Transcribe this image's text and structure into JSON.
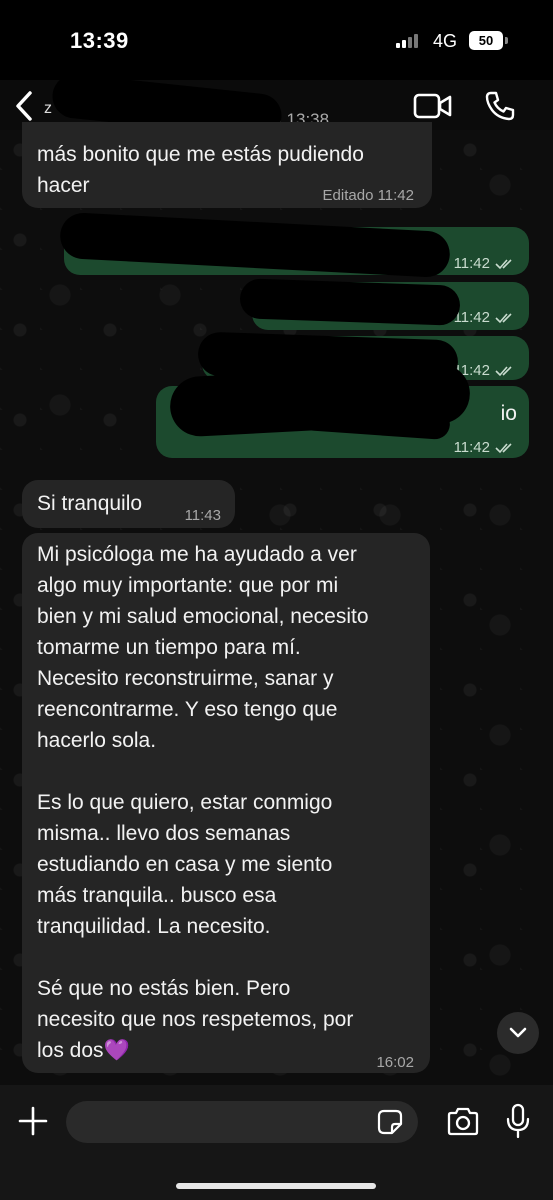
{
  "status_bar": {
    "time": "13:39",
    "network": "4G",
    "battery": "50"
  },
  "header": {
    "contact_initial": "z",
    "last_seen": "(s) 13:38"
  },
  "messages": [
    {
      "direction": "in",
      "text": "más bonito que me estás pudiendo\nhacer",
      "meta": "Editado 11:42"
    },
    {
      "direction": "out",
      "text": "",
      "meta": "11:42"
    },
    {
      "direction": "out",
      "text": "",
      "meta": "11:42"
    },
    {
      "direction": "out",
      "text": "",
      "meta": "11:42"
    },
    {
      "direction": "out",
      "text": "",
      "partial_visible": "io",
      "meta": "11:42"
    },
    {
      "direction": "in",
      "text": "Si tranquilo",
      "meta": "11:43"
    },
    {
      "direction": "in",
      "text": "Mi psicóloga me ha ayudado a ver\nalgo muy importante: que por mi\nbien y mi salud emocional, necesito\ntomarme un tiempo para mí.\nNecesito reconstruirme, sanar y\nreencontrarme. Y eso tengo que\nhacerlo sola.\n\nEs lo que quiero, estar conmigo\nmisma.. llevo dos semanas\nestudiando en casa y me siento\nmás tranquila.. busco esa\ntranquilidad. La necesito.\n\nSé que no estás bien. Pero\nnecesito que nos respetemos, por\nlos dos💜",
      "meta": "16:02"
    }
  ],
  "input": {
    "placeholder": ""
  },
  "colors": {
    "incoming_bubble": "#252525",
    "outgoing_bubble": "#1c4a2e",
    "background": "#0b0b0b"
  },
  "icons": [
    "back-chevron-icon",
    "video-call-icon",
    "phone-icon",
    "chevron-down-icon",
    "plus-icon",
    "sticker-icon",
    "camera-icon",
    "microphone-icon"
  ]
}
